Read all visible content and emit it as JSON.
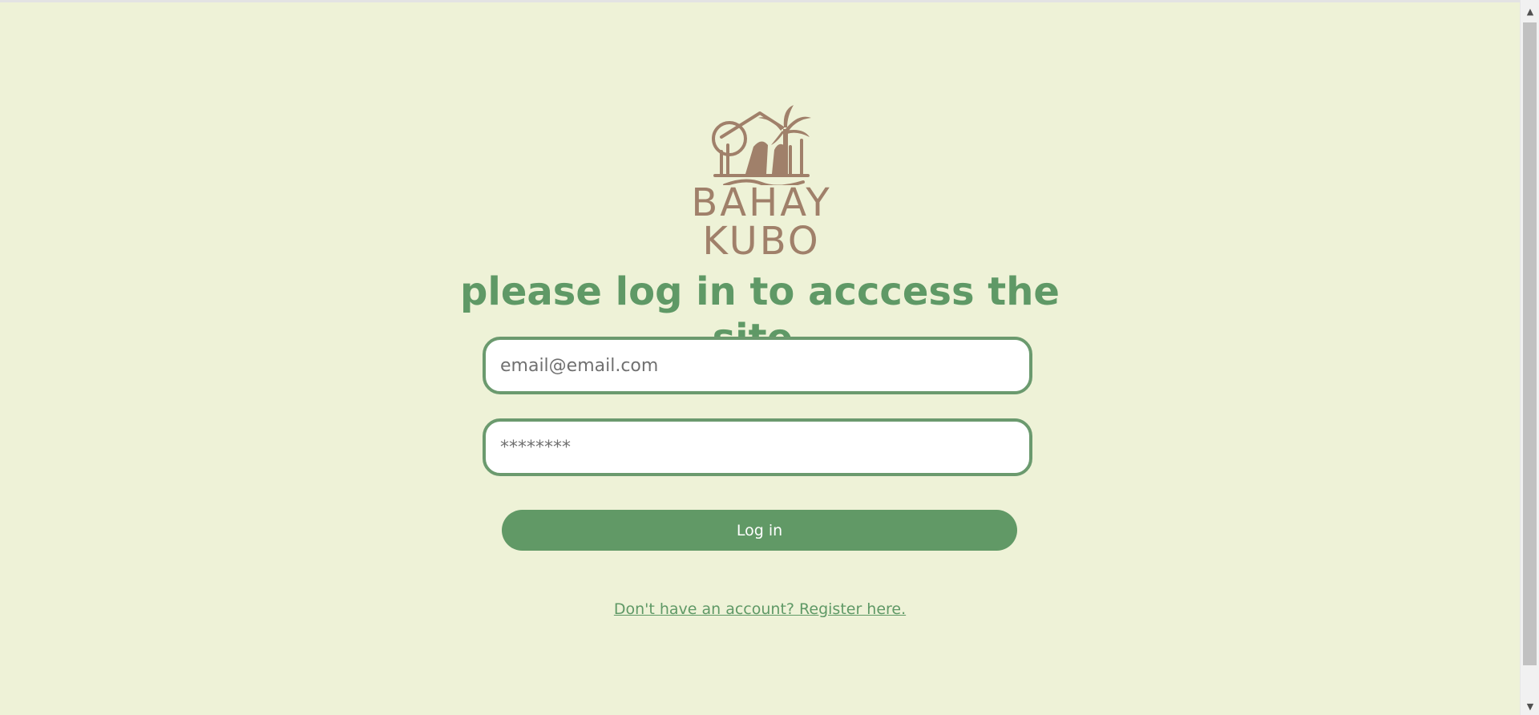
{
  "brand": {
    "name": "BAHAY KUBO",
    "color": "#a0806a",
    "logo_icon": "hut-with-palm-tree-icon"
  },
  "login": {
    "heading": "please log in to acccess the site.",
    "email_placeholder": "email@email.com",
    "password_placeholder": "********",
    "submit_label": "Log in",
    "register_link": "Don't have an account? Register here."
  },
  "colors": {
    "background": "#eef2d7",
    "accent": "#619966",
    "field_border": "#6b9a6e"
  },
  "scrollbar": {
    "up_icon": "scroll-up-arrow-icon",
    "down_icon": "scroll-down-arrow-icon"
  }
}
